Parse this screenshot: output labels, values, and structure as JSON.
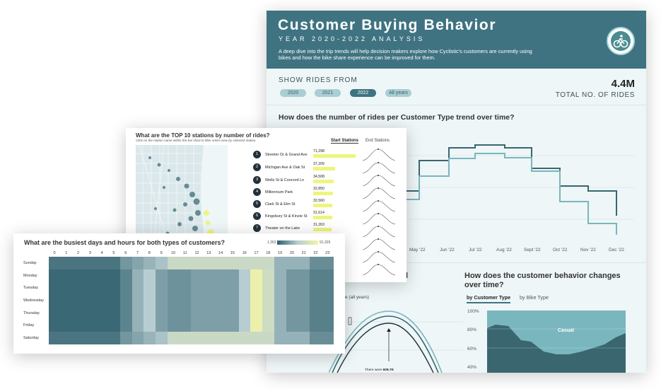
{
  "dashboard": {
    "title": "Customer Buying Behavior",
    "subtitle": "YEAR 2020-2022 ANALYSIS",
    "description": "A deep dive into the trip trends will help decision makers explore how Cyclistic's customers are currently using bikes and how the bike share experience can be improved for them.",
    "logo_icon": "bike-logo-icon",
    "show_rides_label": "SHOW RIDES FROM",
    "year_filters": [
      "2020",
      "2021",
      "2022",
      "All years"
    ],
    "selected_year": "2022",
    "total_rides": "4.4M",
    "total_rides_label": "TOTAL NO. OF RIDES",
    "trend_question": "How does the number of rides per Customer Type trend over time?",
    "months": [
      "May '22",
      "Jun '22",
      "Jul '22",
      "Aug '22",
      "Sept '22",
      "Oct '22",
      "Nov '22",
      "Dec '22"
    ],
    "behavior_question": "How does the customer behavior changes over time?",
    "behavior_tabs": [
      "by Customer Type",
      "by Bike Type"
    ],
    "selected_behavior_tab": "by Customer Type",
    "pct_ticks": [
      "100%",
      "80%",
      "60%",
      "40%"
    ],
    "area_label": "Casual",
    "partial_title_fragment": "l",
    "partial_sub": "e (all years)",
    "annotation_text": "There were",
    "annotation_value": "608.7K",
    "colors": {
      "header": "#3f7381",
      "member_line": "#3a6670",
      "casual_line": "#7ab6bd",
      "highlight": "#eef57a"
    }
  },
  "stations": {
    "title": "What are the TOP 10 stations by number of rides?",
    "subtitle": "Click on the station name within the bar chart to filter entire view by selected station.",
    "tabs": [
      "Start Stations",
      "End Stations"
    ],
    "selected_tab": "Start Stations",
    "list": [
      {
        "rank": "1",
        "name": "Streeter Dr & Grand Ave",
        "value": "71,298"
      },
      {
        "rank": "2",
        "name": "Michigan Ave & Oak St",
        "value": "37,209"
      },
      {
        "rank": "3",
        "name": "Wells St & Concord Ln",
        "value": "34,508"
      },
      {
        "rank": "4",
        "name": "Millennium Park",
        "value": "32,850"
      },
      {
        "rank": "5",
        "name": "Clark St & Elm St",
        "value": "32,560"
      },
      {
        "rank": "6",
        "name": "Kingsbury St & Kinzie St",
        "value": "31,614"
      },
      {
        "rank": "7",
        "name": "Theater on the Lake",
        "value": "31,263"
      }
    ]
  },
  "heatmap": {
    "title": "What are the busiest days and hours for both types of customers?",
    "legend_min": "1,363",
    "legend_max": "91,329",
    "hours": [
      "0",
      "1",
      "2",
      "3",
      "4",
      "5",
      "6",
      "7",
      "8",
      "9",
      "10",
      "11",
      "12",
      "13",
      "14",
      "15",
      "16",
      "17",
      "18",
      "19",
      "20",
      "21",
      "22",
      "23"
    ],
    "days": [
      "Sunday",
      "Monday",
      "Tuesday",
      "Wednesday",
      "Thursday",
      "Friday",
      "Saturday"
    ]
  }
}
